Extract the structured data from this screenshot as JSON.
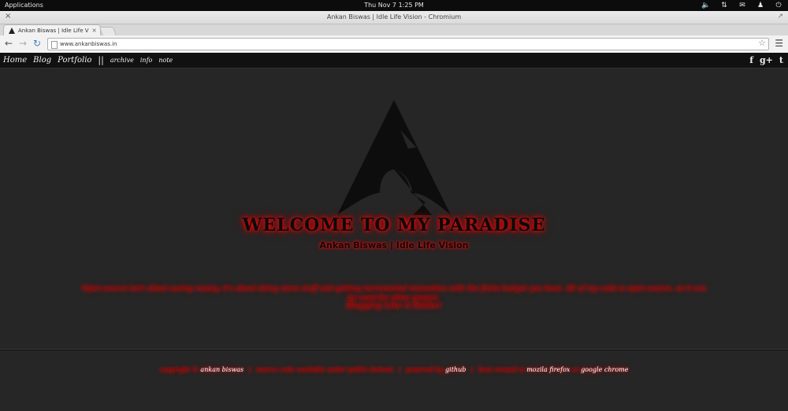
{
  "topbar": {
    "applications": "Applications",
    "clock": "Thu Nov  7  1:25 PM",
    "tray_icons": [
      "volume-icon",
      "network-icon",
      "mail-icon",
      "user-icon",
      "power-icon"
    ]
  },
  "window": {
    "title": "Ankan Biswas | Idle Life Vision - Chromium"
  },
  "tab": {
    "label": "Ankan Biswas | Idle Life Vi"
  },
  "toolbar": {
    "url": "www.ankanbiswas.in"
  },
  "site_nav": {
    "left": [
      "Home",
      "Blog",
      "Portfolio"
    ],
    "separator": "||",
    "right_links": [
      "archive",
      "info",
      "note"
    ],
    "social": [
      "f",
      "g+",
      "t"
    ]
  },
  "hero": {
    "welcome": "WELCOME TO MY PARADISE",
    "subtitle": "Ankan Biswas | Idle Life Vision"
  },
  "body": {
    "description": "Open source isn't about saving money, it's about doing more stuff and getting incremental innovation with the finite budget you have. All of my code is open source, so it can be used for other project.",
    "motto": "Blogging Like A Hacker"
  },
  "footer": {
    "prefix": "copyright ©",
    "author": "ankan biswas",
    "source": "source code available under public domain",
    "powered_prefix": "powered by",
    "powered_by": "github",
    "best_prefix": "best viewed in",
    "browser1": "mozila firefox",
    "and": "or",
    "browser2": "google chrome",
    "separator": "|"
  },
  "colors": {
    "glow_red": "#e11111",
    "background": "#262626",
    "nav_bar": "#111111"
  }
}
